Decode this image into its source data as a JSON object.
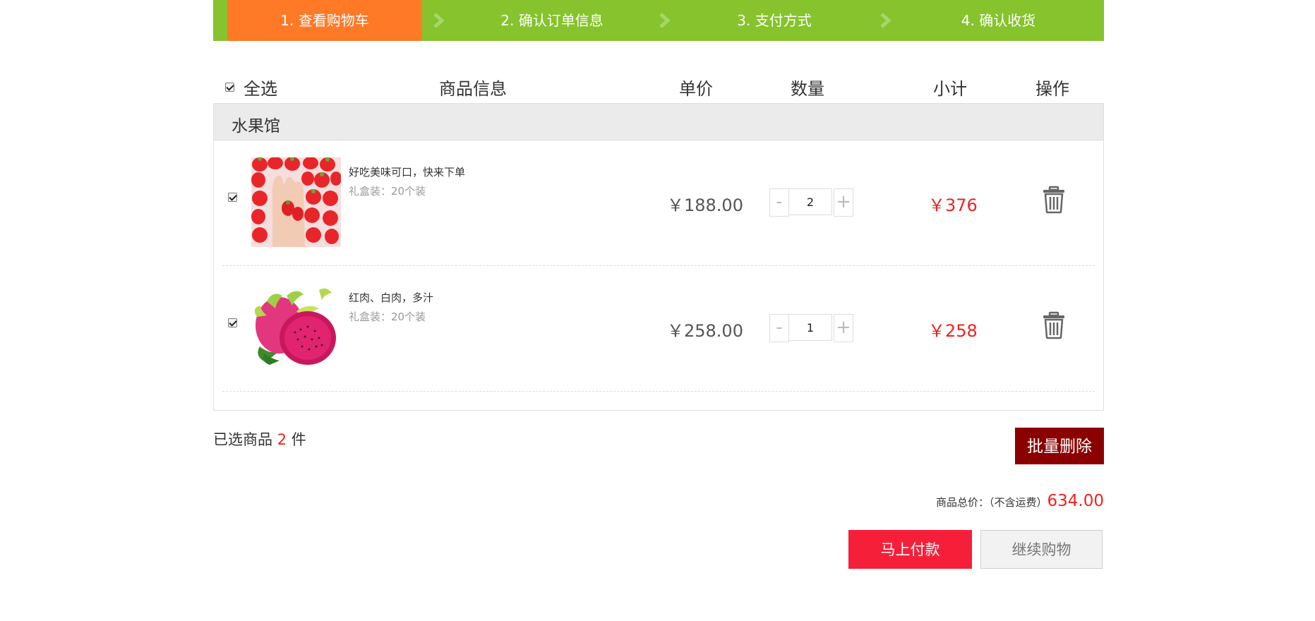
{
  "steps": [
    {
      "label": "1. 查看购物车",
      "active": true
    },
    {
      "label": "2. 确认订单信息",
      "active": false
    },
    {
      "label": "3. 支付方式",
      "active": false
    },
    {
      "label": "4. 确认收货",
      "active": false
    }
  ],
  "table_header": {
    "select_all_label": "全选",
    "select_all_checked": true,
    "product_info": "商品信息",
    "unit_price": "单价",
    "quantity": "数量",
    "subtotal": "小计",
    "action": "操作"
  },
  "shop": {
    "name": "水果馆",
    "items": [
      {
        "checked": true,
        "image": "strawberry-image",
        "name": "好吃美味可口，快来下单",
        "spec": "礼盒装：20个装",
        "price": "￥188.00",
        "minus": "-",
        "quantity": "2",
        "plus": "+",
        "subtotal": "￥376",
        "delete_icon": "trash-icon"
      },
      {
        "checked": true,
        "image": "dragon-fruit-image",
        "name": "红肉、白肉，多汁",
        "spec": "礼盒装：20个装",
        "price": "￥258.00",
        "minus": "-",
        "quantity": "1",
        "plus": "+",
        "subtotal": "￥258",
        "delete_icon": "trash-icon"
      }
    ]
  },
  "footer": {
    "selected_prefix": "已选商品",
    "selected_count": "2",
    "selected_suffix": "件",
    "batch_delete": "批量删除",
    "total_label": "商品总价：（不含运费）",
    "total_amount": "634.00",
    "pay_button": "马上付款",
    "continue_button": "继续购物"
  },
  "colors": {
    "step_bar": "#86c32c",
    "step_active": "#fe7a27",
    "price_red": "#f0221f",
    "batch_delete_bg": "#8b0000",
    "pay_bg": "#f61f3a"
  }
}
